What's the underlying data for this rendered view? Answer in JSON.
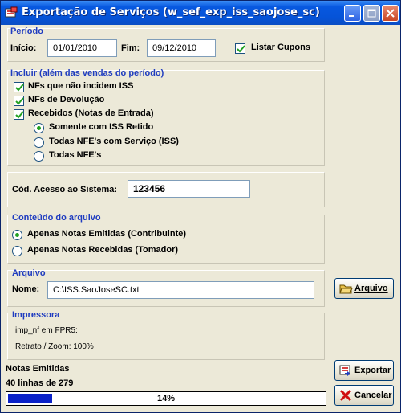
{
  "window": {
    "title": "Exportação de Serviços (w_sef_exp_iss_saojose_sc)"
  },
  "periodo": {
    "group_label": "Período",
    "inicio_label": "Início:",
    "inicio_value": "01/01/2010",
    "fim_label": "Fim:",
    "fim_value": "09/12/2010",
    "listar_cupons_label": "Listar Cupons",
    "listar_cupons_checked": true
  },
  "incluir": {
    "group_label": "Incluir (além das vendas do período)",
    "items": [
      {
        "label": "NFs que não incidem ISS",
        "checked": true
      },
      {
        "label": "NFs de Devolução",
        "checked": true
      },
      {
        "label": "Recebidos (Notas de Entrada)",
        "checked": true
      }
    ],
    "radios": [
      {
        "label": "Somente com ISS Retido",
        "selected": true
      },
      {
        "label": "Todas NFE's com Serviço (ISS)",
        "selected": false
      },
      {
        "label": "Todas NFE's",
        "selected": false
      }
    ]
  },
  "acesso": {
    "label": "Cód. Acesso ao Sistema:",
    "value": "123456"
  },
  "conteudo": {
    "group_label": "Conteúdo do arquivo",
    "options": [
      {
        "label": "Apenas Notas Emitidas (Contribuinte)",
        "selected": true
      },
      {
        "label": "Apenas Notas Recebidas (Tomador)",
        "selected": false
      }
    ]
  },
  "arquivo": {
    "group_label": "Arquivo",
    "nome_label": "Nome:",
    "nome_value": "C:\\ISS.SaoJoseSC.txt",
    "button_label": "Arquivo"
  },
  "impressora": {
    "group_label": "Impressora",
    "line1": "imp_nf em FPR5:",
    "line2": "Retrato / Zoom: 100%"
  },
  "status": {
    "title": "Notas Emitidas",
    "count_text": "40 linhas de 279",
    "progress_percent": 14,
    "progress_text": "14%"
  },
  "buttons": {
    "exportar": "Exportar",
    "cancelar": "Cancelar"
  },
  "colors": {
    "title_bar": "#0553d8",
    "group_label": "#1f3cc0",
    "progress_fill": "#0b22c8",
    "radio_dot": "#21a121"
  }
}
